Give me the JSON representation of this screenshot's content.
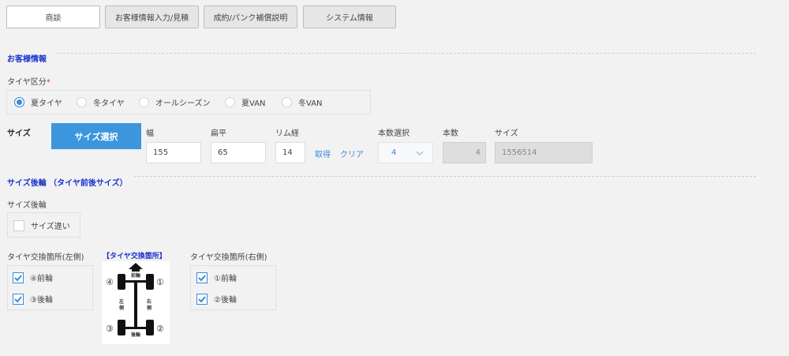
{
  "tabs": [
    {
      "label": "商談",
      "active": true
    },
    {
      "label": "お客様情報入力/見積",
      "active": false
    },
    {
      "label": "成約/パンク補償説明",
      "active": false
    },
    {
      "label": "システム情報",
      "active": false
    }
  ],
  "customer_section": {
    "title": "お客様情報",
    "tire_type_label": "タイヤ区分",
    "required_mark": "*",
    "tire_options": [
      {
        "label": "夏タイヤ",
        "selected": true
      },
      {
        "label": "冬タイヤ",
        "selected": false
      },
      {
        "label": "オールシーズン",
        "selected": false
      },
      {
        "label": "夏VAN",
        "selected": false
      },
      {
        "label": "冬VAN",
        "selected": false
      }
    ]
  },
  "size": {
    "label": "サイズ",
    "select_button": "サイズ選択",
    "width_label": "幅",
    "width_value": "155",
    "aspect_label": "扁平",
    "aspect_value": "65",
    "rim_label": "リム経",
    "rim_value": "14",
    "fetch_link": "取得",
    "clear_link": "クリア",
    "count_select_label": "本数選択",
    "count_select_value": "4",
    "count_label": "本数",
    "count_value": "4",
    "size_label": "サイズ",
    "size_value": "1556514"
  },
  "rear_section": {
    "title": "サイズ後輪 （タイヤ前後サイズ）",
    "rear_label": "サイズ後輪",
    "size_diff_label": "サイズ違い",
    "size_diff_checked": false,
    "left_title": "タイヤ交換箇所(左側)",
    "left_options": [
      {
        "label": "④前輪",
        "checked": true
      },
      {
        "label": "③後輪",
        "checked": true
      }
    ],
    "diagram_title": "【タイヤ交換箇所】",
    "diagram": {
      "front": "前輪",
      "rear": "後輪",
      "left": "左側",
      "right": "右側",
      "n1": "①",
      "n2": "②",
      "n3": "③",
      "n4": "④"
    },
    "right_title": "タイヤ交換箇所(右側)",
    "right_options": [
      {
        "label": "①前輪",
        "checked": true
      },
      {
        "label": "②後輪",
        "checked": true
      }
    ]
  },
  "colors": {
    "accent": "#3c96de",
    "section_title": "#1a33cc",
    "required": "#e0303a"
  }
}
